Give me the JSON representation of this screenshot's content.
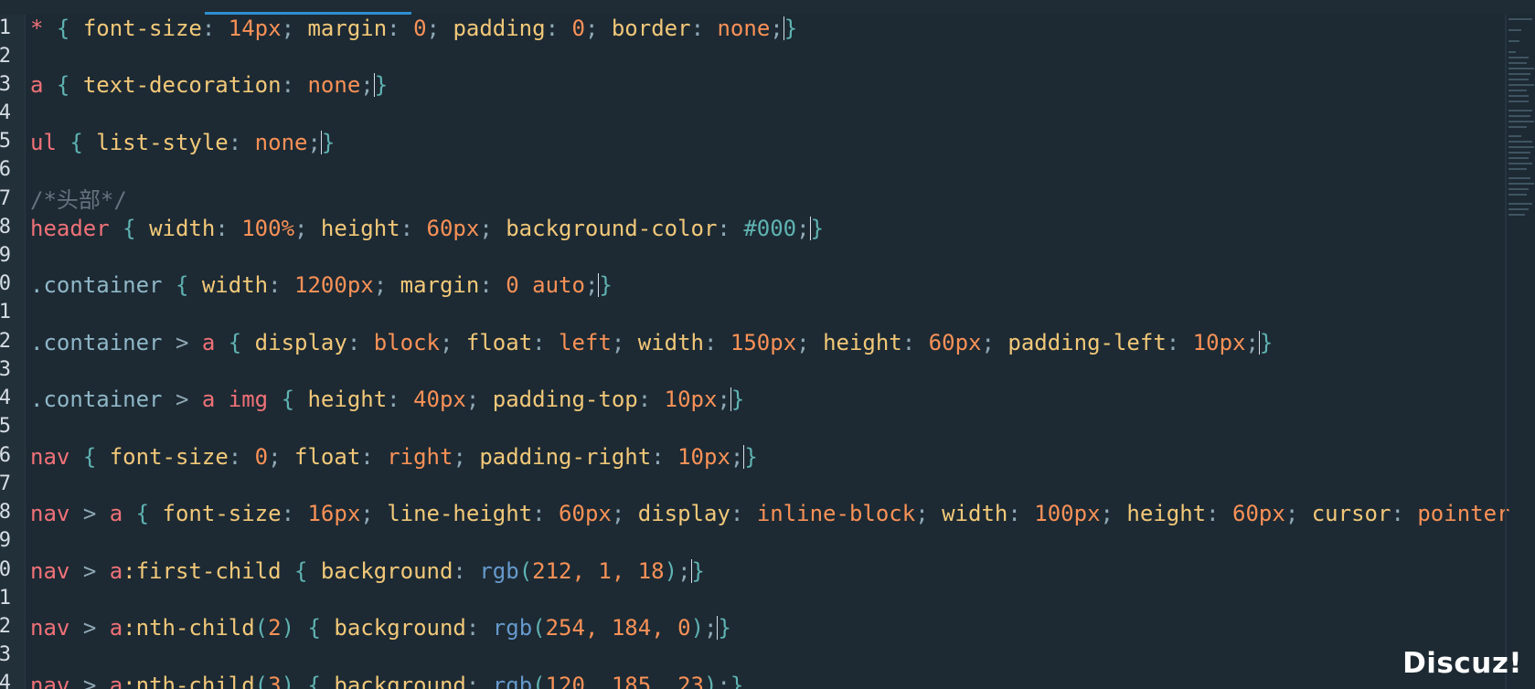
{
  "editor": {
    "line_numbers": [
      "1",
      "2",
      "3",
      "4",
      "5",
      "6",
      "7",
      "8",
      "9",
      "0",
      "1",
      "2",
      "3",
      "4",
      "5",
      "6",
      "7",
      "8",
      "9",
      "0",
      "1",
      "2",
      "3",
      "4"
    ],
    "lines": {
      "l1": {
        "sel": "*",
        "b1": "{",
        "p1": "font-size",
        "v1": "14px",
        "p2": "margin",
        "v2": "0",
        "p3": "padding",
        "v3": "0",
        "p4": "border",
        "v4": "none",
        "b2": "}"
      },
      "l3": {
        "sel": "a",
        "b1": "{",
        "p1": "text-decoration",
        "v1": "none",
        "b2": "}"
      },
      "l5": {
        "sel": "ul",
        "b1": "{",
        "p1": "list-style",
        "v1": "none",
        "b2": "}"
      },
      "l7": {
        "comment": "/*头部*/"
      },
      "l8": {
        "sel": "header",
        "b1": "{",
        "p1": "width",
        "v1": "100%",
        "p2": "height",
        "v2": "60px",
        "p3": "background-color",
        "v3": "#000",
        "b2": "}"
      },
      "l10": {
        "sel": ".container",
        "b1": "{",
        "p1": "width",
        "v1": "1200px",
        "p2": "margin",
        "v2": "0 auto",
        "b2": "}"
      },
      "l12": {
        "sel": ".container",
        "comb": ">",
        "sel2": "a",
        "b1": "{",
        "p1": "display",
        "v1": "block",
        "p2": "float",
        "v2": "left",
        "p3": "width",
        "v3": "150px",
        "p4": "height",
        "v4": "60px",
        "p5": "padding-left",
        "v5": "10px",
        "b2": "}"
      },
      "l14": {
        "sel": ".container",
        "comb": ">",
        "sel2": "a img",
        "b1": "{",
        "p1": "height",
        "v1": "40px",
        "p2": "padding-top",
        "v2": "10px",
        "b2": "}"
      },
      "l16": {
        "sel": "nav",
        "b1": "{",
        "p1": "font-size",
        "v1": "0",
        "p2": "float",
        "v2": "right",
        "p3": "padding-right",
        "v3": "10px",
        "b2": "}"
      },
      "l18": {
        "sel": "nav",
        "comb": ">",
        "sel2": "a",
        "b1": "{",
        "p1": "font-size",
        "v1": "16px",
        "p2": "line-height",
        "v2": "60px",
        "p3": "display",
        "v3": "inline-block",
        "p4": "width",
        "v4": "100px",
        "p5": "height",
        "v5": "60px",
        "p6": "cursor",
        "v6": "pointer"
      },
      "l20": {
        "sel": "nav",
        "comb": ">",
        "sel2": "a",
        "pseudo": ":first-child",
        "b1": "{",
        "p1": "background",
        "fn": "rgb",
        "args": "212, 1, 18",
        "b2": "}"
      },
      "l22": {
        "sel": "nav",
        "comb": ">",
        "sel2": "a",
        "pseudo": ":nth-child",
        "pseudo_arg": "2",
        "b1": "{",
        "p1": "background",
        "fn": "rgb",
        "args": "254, 184, 0",
        "b2": "}"
      },
      "l24": {
        "sel": "nav",
        "comb": ">",
        "sel2": "a",
        "pseudo": ":nth-child",
        "pseudo_arg": "3",
        "b1": "{",
        "p1": "background",
        "fn": "rgb",
        "args": "120, 185, 23",
        "b2": "}"
      }
    }
  },
  "watermark": "Discuz!",
  "colors": {
    "background": "#1d2a33",
    "selector": "#f07178",
    "property": "#f2c879",
    "value": "#f99157",
    "brace": "#5fb3b3",
    "function": "#6699cc",
    "comment": "#65737e",
    "tab_indicator": "#2f8fd1"
  }
}
